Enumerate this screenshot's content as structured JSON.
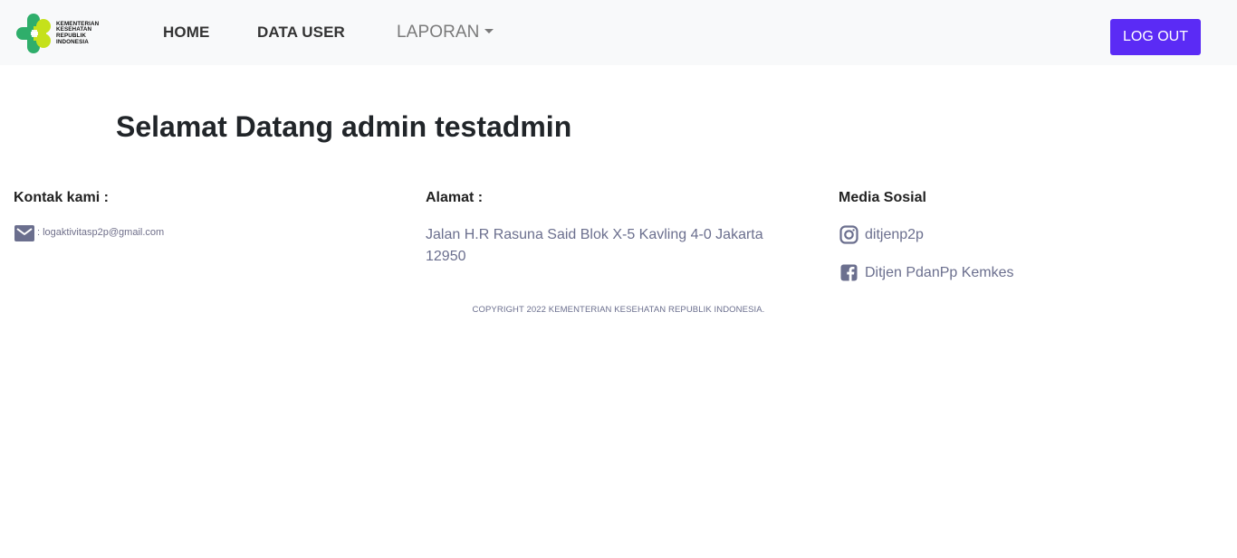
{
  "navbar": {
    "logo_lines": [
      "KEMENTERIAN",
      "KESEHATAN",
      "REPUBLIK",
      "INDONESIA"
    ],
    "links": [
      {
        "label": "HOME"
      },
      {
        "label": "DATA USER"
      },
      {
        "label": "LAPORAN"
      }
    ],
    "logout_label": "LOG OUT"
  },
  "main": {
    "welcome": "Selamat Datang admin testadmin"
  },
  "footer": {
    "kontak": {
      "heading": "Kontak kami :",
      "email": ": logaktivitasp2p@gmail.com"
    },
    "alamat": {
      "heading": "Alamat :",
      "text": "Jalan H.R Rasuna Said Blok X-5 Kavling 4-0 Jakarta 12950"
    },
    "media": {
      "heading": "Media Sosial",
      "instagram": "ditjenp2p",
      "facebook": "Ditjen PdanPp Kemkes"
    },
    "copyright": "COPYRIGHT 2022 KEMENTERIAN KESEHATAN REPUBLIK INDONESIA."
  },
  "colors": {
    "navbar_bg": "#f8f9fa",
    "logout_bg": "#5b2bf5",
    "muted_text": "#6b6f8e"
  }
}
